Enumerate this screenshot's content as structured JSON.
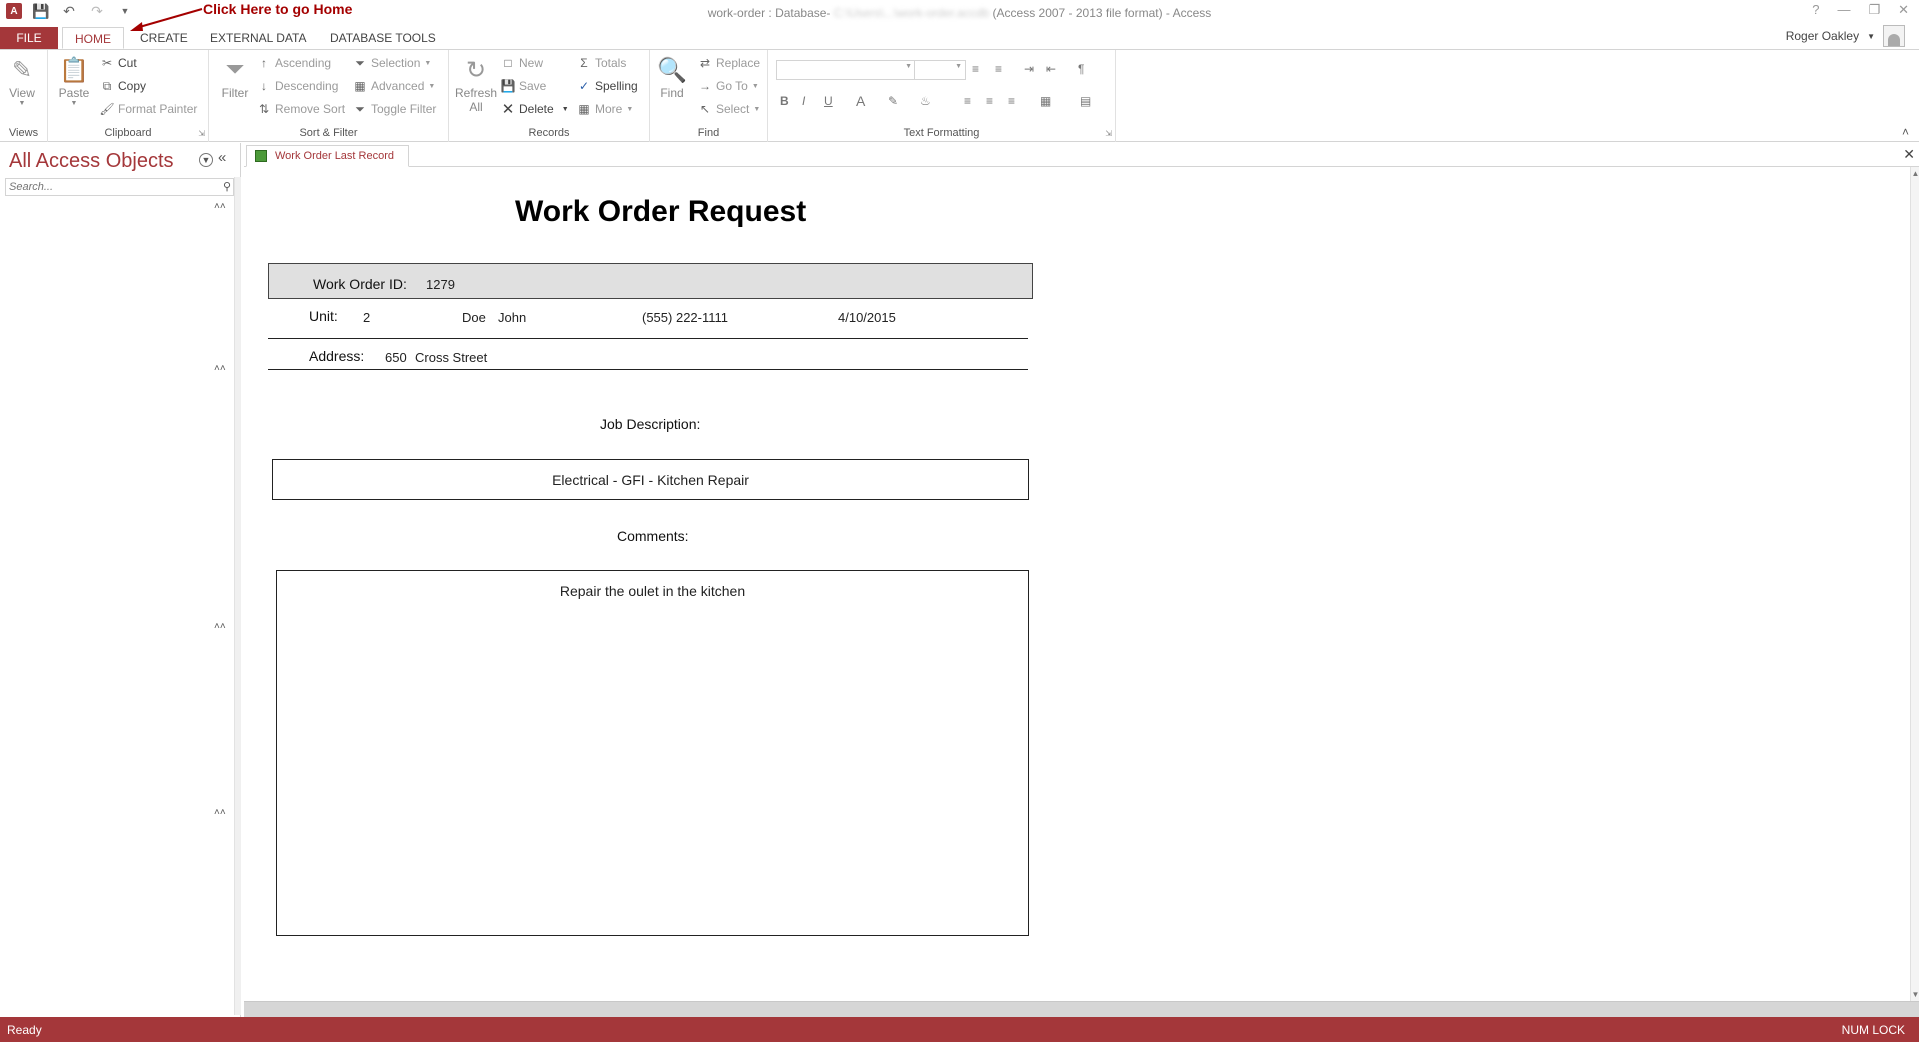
{
  "title_bar": {
    "window_title_prefix": "work-order : Database-",
    "window_title_path": "C:\\Users\\...\\work-order.accdb",
    "window_title_suffix": "(Access 2007 - 2013 file format) - Access",
    "annotation": "Click Here to go Home"
  },
  "tabs": {
    "file": "FILE",
    "home": "HOME",
    "create": "CREATE",
    "external_data": "EXTERNAL DATA",
    "database_tools": "DATABASE TOOLS"
  },
  "user": {
    "name": "Roger Oakley"
  },
  "ribbon": {
    "views": {
      "view": "View",
      "label": "Views"
    },
    "clipboard": {
      "paste": "Paste",
      "cut": "Cut",
      "copy": "Copy",
      "format_painter": "Format Painter",
      "label": "Clipboard"
    },
    "sort_filter": {
      "filter": "Filter",
      "ascending": "Ascending",
      "descending": "Descending",
      "remove_sort": "Remove Sort",
      "selection": "Selection",
      "advanced": "Advanced",
      "toggle_filter": "Toggle Filter",
      "label": "Sort & Filter"
    },
    "records": {
      "refresh_all_1": "Refresh",
      "refresh_all_2": "All",
      "new": "New",
      "save": "Save",
      "delete": "Delete",
      "totals": "Totals",
      "spelling": "Spelling",
      "more": "More",
      "label": "Records"
    },
    "find": {
      "find": "Find",
      "replace": "Replace",
      "go_to": "Go To",
      "select": "Select",
      "label": "Find"
    },
    "text_formatting": {
      "bold": "B",
      "italic": "I",
      "underline": "U",
      "font_color": "A",
      "label": "Text Formatting"
    }
  },
  "nav": {
    "title": "All Access Objects",
    "search_placeholder": "Search..."
  },
  "document": {
    "tab_label": "Work Order Last Record",
    "form": {
      "title": "Work Order Request",
      "work_order_id_label": "Work Order ID:",
      "work_order_id": "1279",
      "unit_label": "Unit:",
      "unit": "2",
      "last_name": "Doe",
      "first_name": "John",
      "phone": "(555) 222-1111",
      "date": "4/10/2015",
      "address_label": "Address:",
      "address_number": "650",
      "address_street": "Cross Street",
      "job_description_label": "Job Description:",
      "job_description": "Electrical - GFI - Kitchen Repair",
      "comments_label": "Comments:",
      "comments": "Repair the oulet in the kitchen"
    }
  },
  "status": {
    "left": "Ready",
    "right": "NUM LOCK"
  },
  "colors": {
    "accent": "#a4373a",
    "header_fill": "#e0e0e0"
  }
}
